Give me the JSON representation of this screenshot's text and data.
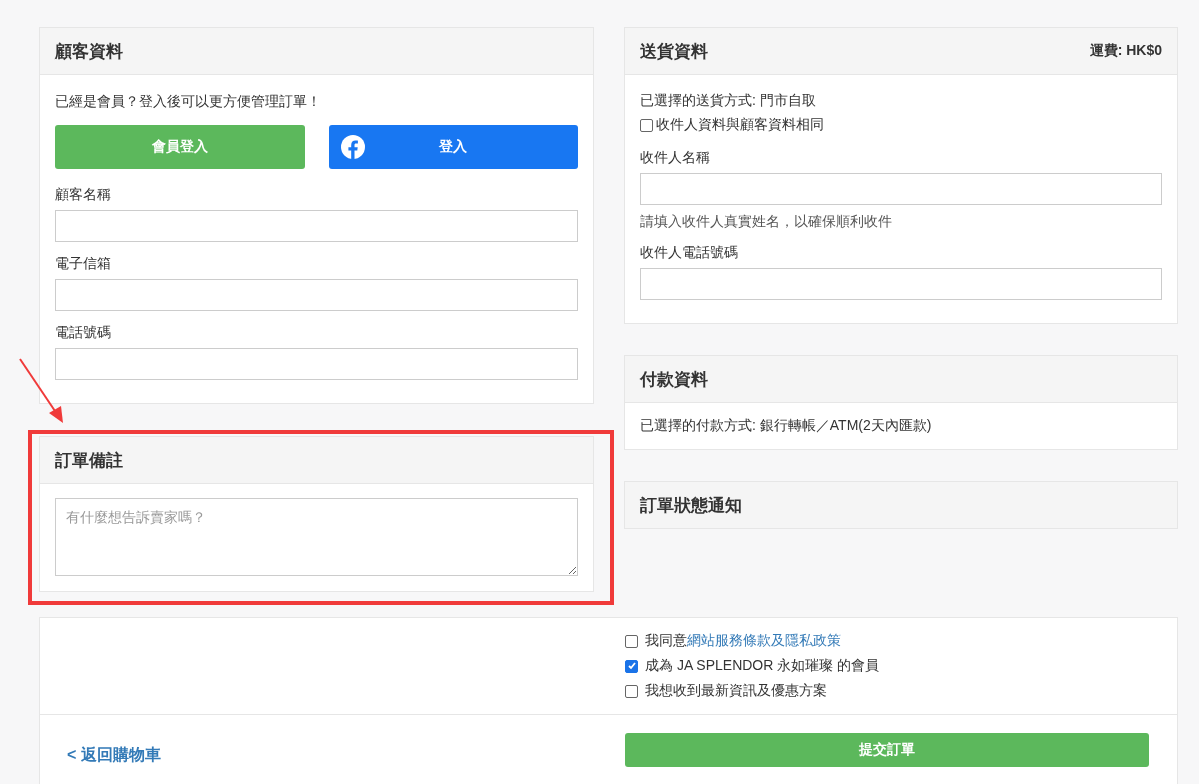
{
  "customer": {
    "title": "顧客資料",
    "prompt": "已經是會員？登入後可以更方便管理訂單！",
    "buttons": [
      {
        "label": "會員登入",
        "kind": "member"
      },
      {
        "label": "登入",
        "kind": "facebook"
      }
    ],
    "fields": [
      {
        "label": "顧客名稱"
      },
      {
        "label": "電子信箱"
      },
      {
        "label": "電話號碼"
      }
    ]
  },
  "notes": {
    "title": "訂單備註",
    "placeholder": "有什麼想告訴賣家嗎？"
  },
  "shipping": {
    "title": "送貨資料",
    "fee": "運費: HK$0",
    "method": "已選擇的送貨方式: 門市自取",
    "same_as_customer": {
      "label": "收件人資料與顧客資料相同",
      "checked": false
    },
    "fields": [
      {
        "label": "收件人名稱",
        "help": "請填入收件人真實姓名，以確保順利收件"
      },
      {
        "label": "收件人電話號碼"
      }
    ]
  },
  "payment": {
    "title": "付款資料",
    "method": "已選擇的付款方式: 銀行轉帳／ATM(2天內匯款)"
  },
  "status_notice": {
    "title": "訂單狀態通知"
  },
  "agreements": [
    {
      "text": "我同意",
      "link": "網站服務條款及隱私政策",
      "checked": false
    },
    {
      "text": "成為 JA SPLENDOR 永如璀璨 的會員",
      "checked": true
    },
    {
      "text": "我想收到最新資訊及優惠方案",
      "checked": false
    }
  ],
  "back_link": "< 返回購物車",
  "submit": "提交訂單"
}
